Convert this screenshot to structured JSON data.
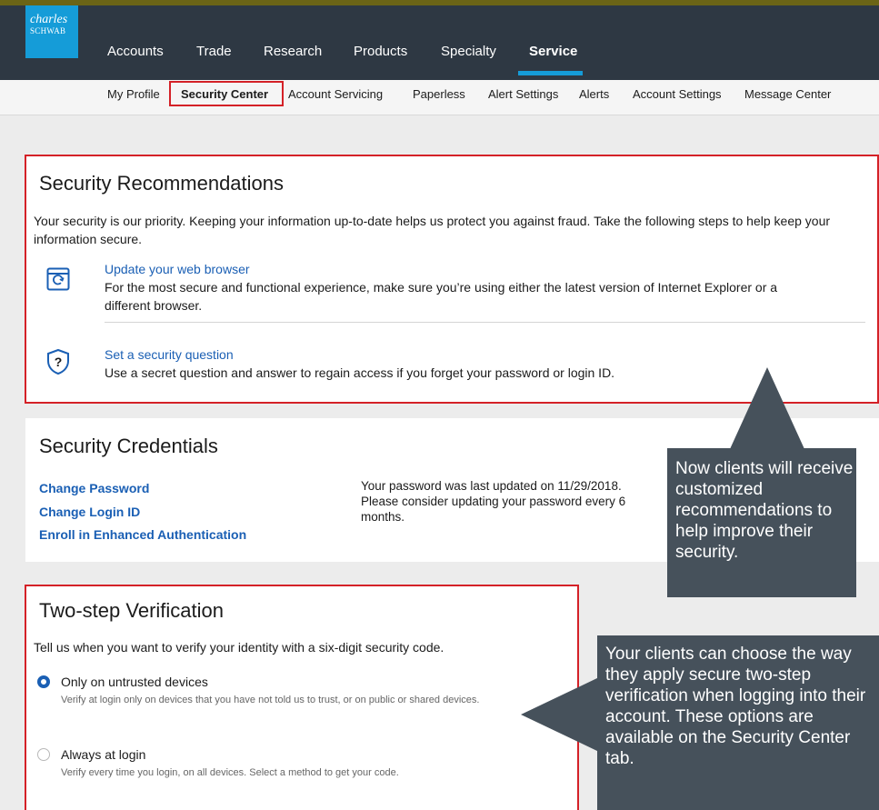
{
  "brand": {
    "line1": "charles",
    "line2": "SCHWAB"
  },
  "nav": {
    "items": [
      {
        "label": "Accounts"
      },
      {
        "label": "Trade"
      },
      {
        "label": "Research"
      },
      {
        "label": "Products"
      },
      {
        "label": "Specialty"
      },
      {
        "label": "Service"
      }
    ],
    "active": "Service"
  },
  "subnav": {
    "items": [
      {
        "label": "My Profile"
      },
      {
        "label": "Security Center"
      },
      {
        "label": "Account Servicing"
      },
      {
        "label": "Paperless"
      },
      {
        "label": "Alert Settings"
      },
      {
        "label": "Alerts"
      },
      {
        "label": "Account Settings"
      },
      {
        "label": "Message Center"
      }
    ],
    "active": "Security Center"
  },
  "recommendations": {
    "title": "Security Recommendations",
    "intro": "Your security is our priority. Keeping your information up-to-date helps us protect you against fraud. Take the following steps to help keep your information secure.",
    "items": [
      {
        "icon": "browser-refresh-icon",
        "link": "Update your web browser",
        "text": "For the most secure and functional experience, make sure you’re using either the latest version of Internet Explorer or a different browser."
      },
      {
        "icon": "shield-question-icon",
        "link": "Set a security question",
        "text": "Use a secret question and answer to regain access if you forget your password or login ID."
      }
    ]
  },
  "credentials": {
    "title": "Security Credentials",
    "links": [
      "Change Password",
      "Change Login ID",
      "Enroll in Enhanced Authentication"
    ],
    "password_note": "Your password was last updated on 11/29/2018. Please consider updating your password every 6 months."
  },
  "two_step": {
    "title": "Two-step Verification",
    "intro": "Tell us when you want to verify your identity with a six-digit security code.",
    "options": [
      {
        "label": "Only on untrusted devices",
        "desc": "Verify at login only on devices that you have not told us to trust, or on public or shared devices.",
        "selected": true
      },
      {
        "label": "Always at login",
        "desc": "Verify every time you login, on all devices. Select a method to get your code.",
        "selected": false
      }
    ]
  },
  "callouts": {
    "one": "Now clients will receive customized recommendations to help improve their security.",
    "two": "Your clients can choose the way they apply secure two-step verification when logging into their account. These options are available on the Security Center tab."
  },
  "colors": {
    "nav_bg": "#2e3843",
    "brand_blue": "#159cd8",
    "highlight_red": "#d42127",
    "link_blue": "#1a5fb4",
    "callout_bg": "#46515b"
  }
}
